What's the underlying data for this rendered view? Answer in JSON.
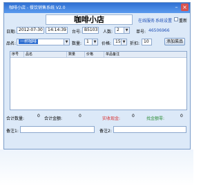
{
  "window": {
    "title": "咖啡小店 - 餐饮销售系统 V2.0"
  },
  "header": {
    "shop_name": "咖啡小店",
    "online_service": "在线服务",
    "settings": "系统设置",
    "reset_label": "重新"
  },
  "form": {
    "date_label": "日期:",
    "date_value": "2012-07-30",
    "time_value": "14:14:39",
    "table_label": "台号:",
    "table_value": "B5103",
    "people_label": "人数:",
    "people_value": "2",
    "order_label": "单号:",
    "order_value": "46506966",
    "item_label": "品名:",
    "item_value": "一杯咖啡",
    "qty_label": "数量:",
    "qty_value": "1",
    "price_label": "价格:",
    "price_value": "15",
    "discount_label": "折扣:",
    "discount_value": "10",
    "add_button": "添加菜品"
  },
  "grid": {
    "columns": [
      "序号",
      "品名",
      "数量",
      "价格",
      "单品备注"
    ]
  },
  "summary": {
    "total_qty_label": "合计数量:",
    "total_qty_value": "0",
    "total_amount_label": "合计金额:",
    "total_amount_value": "0",
    "actual_cash_label": "实收现金:",
    "actual_cash_value": "0",
    "change_label": "找金额零:",
    "change_value": "0",
    "note1_label": "备注1:",
    "note2_label": "备注2:"
  },
  "colors": {
    "accent": "#2f6fd1",
    "panel": "#dce9f8",
    "red": "#d8292a",
    "green": "#2f8f3a"
  }
}
